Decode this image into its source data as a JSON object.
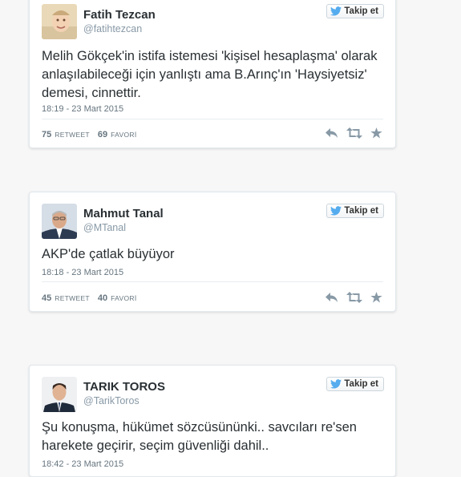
{
  "tweets": [
    {
      "name": "Fatih Tezcan",
      "handle": "@fatihtezcan",
      "follow_label": "Takip et",
      "text": "Melih Gökçek'in istifa istemesi 'kişisel hesaplaşma' olarak anlaşılabileceği için yanlıştı ama B.Arınç'ın 'Haysiyetsiz' demesi, cinnettir.",
      "timestamp": "18:19 - 23 Mart 2015",
      "retweets": "75",
      "retweet_label": "RETWEET",
      "favorites": "69",
      "favorite_label": "FAVORİ"
    },
    {
      "name": "Mahmut Tanal",
      "handle": "@MTanal",
      "follow_label": "Takip et",
      "text": "AKP'de çatlak büyüyor",
      "timestamp": "18:18 - 23 Mart 2015",
      "retweets": "45",
      "retweet_label": "RETWEET",
      "favorites": "40",
      "favorite_label": "FAVORİ"
    },
    {
      "name": "TARIK TOROS",
      "handle": "@TarikToros",
      "follow_label": "Takip et",
      "text": "Şu konuşma, hükümet sözcüsününki.. savcıları re'sen harekete geçirir, seçim güvenliği dahil..",
      "timestamp": "18:42 - 23 Mart 2015"
    }
  ],
  "icons": {
    "follow": "twitter-bird-icon",
    "reply": "reply-icon",
    "retweet": "retweet-icon",
    "favorite": "star-icon"
  },
  "colors": {
    "twitter_blue": "#55acee",
    "action_gray": "#8899a6",
    "border": "#e1e8ed"
  }
}
